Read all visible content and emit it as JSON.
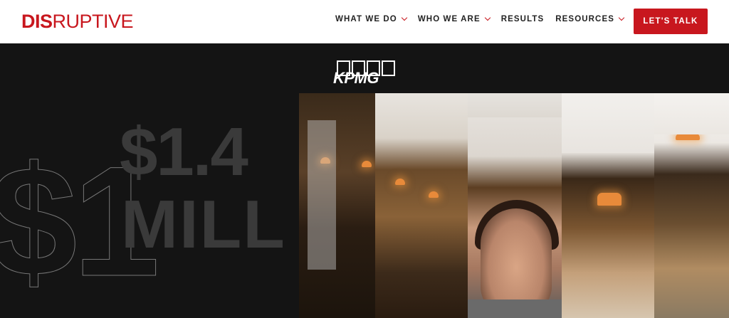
{
  "header": {
    "logo": {
      "bold": "DIS",
      "light": "RUPTIVE"
    },
    "nav": [
      {
        "label": "WHAT WE DO",
        "has_dropdown": true
      },
      {
        "label": "WHO WE ARE",
        "has_dropdown": true
      },
      {
        "label": "RESULTS",
        "has_dropdown": false
      },
      {
        "label": "RESOURCES",
        "has_dropdown": true
      }
    ],
    "cta_label": "LET'S TALK"
  },
  "hero": {
    "client_logo": "KPMG",
    "stat_line1": "$1.4",
    "stat_line2": "MILL",
    "outline_text": "$1"
  },
  "colors": {
    "brand_red": "#c8171e",
    "hero_bg": "#141414",
    "header_bg": "#ffffff"
  },
  "icons": [
    "chevron-down-icon"
  ]
}
